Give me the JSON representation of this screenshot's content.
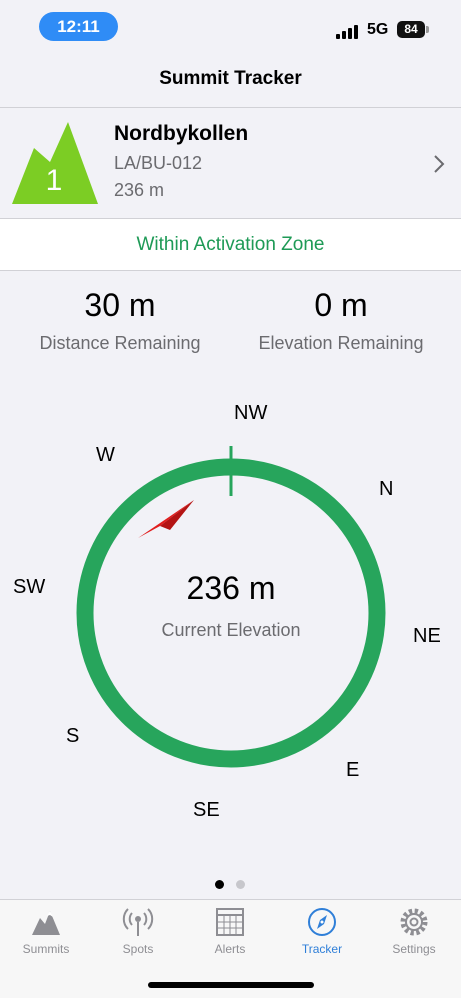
{
  "status_bar": {
    "time": "12:11",
    "network": "5G",
    "battery": "84"
  },
  "nav": {
    "title": "Summit Tracker"
  },
  "summit": {
    "badge_number": "1",
    "name": "Nordbykollen",
    "reference": "LA/BU-012",
    "elevation": "236 m"
  },
  "zone_status": "Within Activation Zone",
  "stats": {
    "distance_value": "30 m",
    "distance_label": "Distance Remaining",
    "elevation_value": "0 m",
    "elevation_label": "Elevation Remaining"
  },
  "compass": {
    "directions": {
      "nw": "NW",
      "n": "N",
      "ne": "NE",
      "e": "E",
      "se": "SE",
      "s": "S",
      "sw": "SW",
      "w": "W"
    },
    "current_elevation": "236 m",
    "current_elevation_label": "Current Elevation",
    "ring_color": "#27a55c",
    "pointer_color": "#e11d1d"
  },
  "pager": {
    "pages": 2,
    "active": 1
  },
  "tabs": [
    {
      "label": "Summits",
      "icon": "mountain-icon"
    },
    {
      "label": "Spots",
      "icon": "antenna-icon"
    },
    {
      "label": "Alerts",
      "icon": "calendar-icon"
    },
    {
      "label": "Tracker",
      "icon": "compass-icon",
      "active": true
    },
    {
      "label": "Settings",
      "icon": "gear-icon"
    }
  ]
}
